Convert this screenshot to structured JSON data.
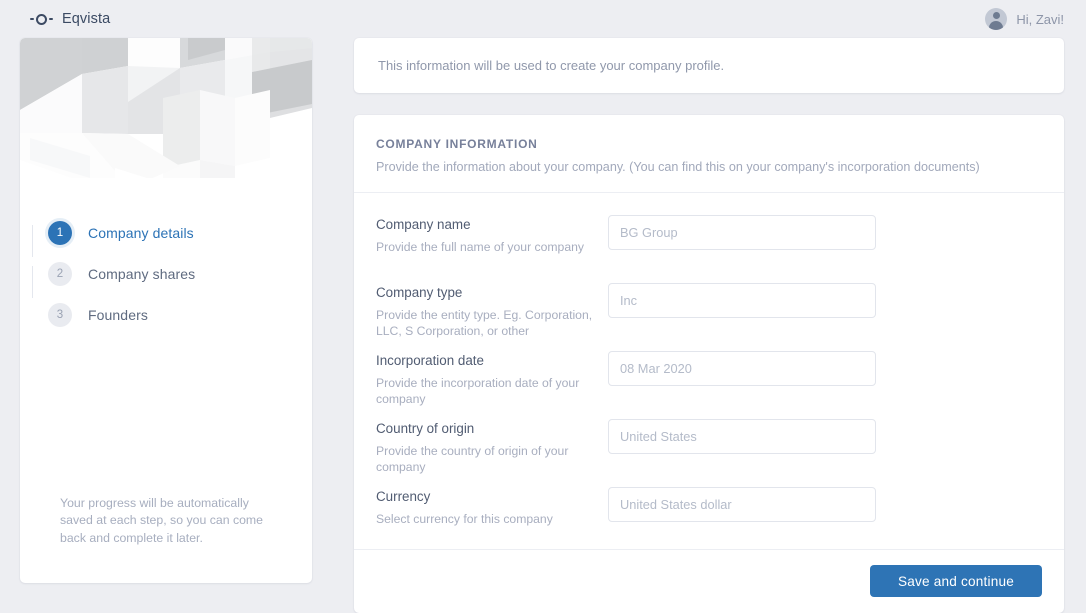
{
  "header": {
    "brand_name": "Eqvista",
    "logo_icon": "dash-circle-dash-logo",
    "greeting": "Hi, Zavi!",
    "avatar_icon": "user-avatar-icon"
  },
  "sidebar": {
    "steps": [
      {
        "number": "1",
        "label": "Company details",
        "state": "active"
      },
      {
        "number": "2",
        "label": "Company shares",
        "state": "inactive"
      },
      {
        "number": "3",
        "label": "Founders",
        "state": "inactive"
      }
    ],
    "note": "Your progress will be automatically saved at each step, so you can come back and complete it later."
  },
  "main": {
    "info_banner": "This information will be used to create your company profile.",
    "form": {
      "title": "COMPANY INFORMATION",
      "subtitle": "Provide the information about your company. (You can find this on your company's incorporation documents)",
      "fields": [
        {
          "label": "Company name",
          "help": "Provide the full name of your company",
          "value": "",
          "placeholder": "BG Group"
        },
        {
          "label": "Company type",
          "help": "Provide the entity type.\nEg. Corporation, LLC, S Corporation, or other",
          "value": "",
          "placeholder": "Inc"
        },
        {
          "label": "Incorporation date",
          "help": "Provide the incorporation date of your company",
          "value": "",
          "placeholder": "08 Mar 2020"
        },
        {
          "label": "Country of origin",
          "help": "Provide the country of origin of your company",
          "value": "",
          "placeholder": "United States"
        },
        {
          "label": "Currency",
          "help": "Select currency for this company",
          "value": "",
          "placeholder": "United States dollar"
        }
      ],
      "submit_label": "Save and continue"
    }
  },
  "colors": {
    "accent": "#2e74b5",
    "page_bg": "#edeef2",
    "card_bg": "#ffffff",
    "muted_text": "#a8aebf"
  }
}
